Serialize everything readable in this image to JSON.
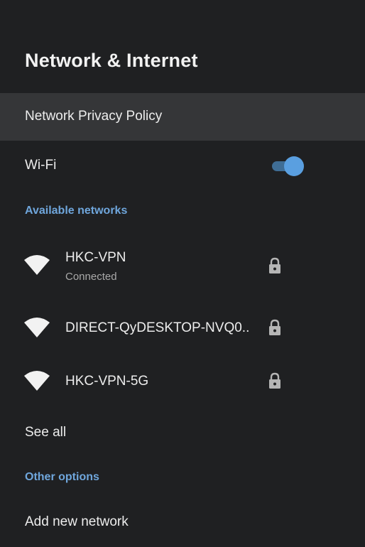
{
  "header": {
    "title": "Network & Internet"
  },
  "privacy": {
    "label": "Network Privacy Policy"
  },
  "wifi": {
    "label": "Wi-Fi",
    "enabled": true
  },
  "available_networks": {
    "header": "Available networks",
    "items": [
      {
        "name": "HKC-VPN",
        "status": "Connected",
        "icon": "wifi-icon",
        "secured": true
      },
      {
        "name": "DIRECT-QyDESKTOP-NVQ0..",
        "status": "",
        "icon": "wifi-icon",
        "secured": true
      },
      {
        "name": "HKC-VPN-5G",
        "status": "",
        "icon": "wifi-icon",
        "secured": true
      }
    ],
    "see_all_label": "See all"
  },
  "other_options": {
    "header": "Other options",
    "add_network_label": "Add new network"
  },
  "colors": {
    "background": "#1f2022",
    "selected_row": "#353638",
    "accent": "#5a9fe0",
    "section_header": "#6fa6dc"
  }
}
